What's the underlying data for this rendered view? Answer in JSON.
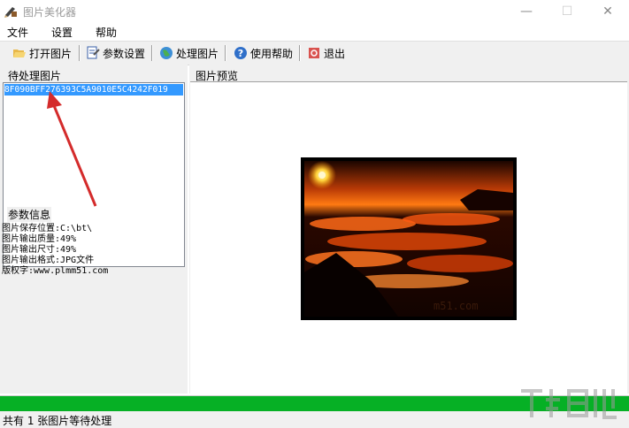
{
  "window": {
    "title": "图片美化器",
    "minimize": "—",
    "maximize": "☐",
    "close": "✕"
  },
  "menu": [
    "文件",
    "设置",
    "帮助"
  ],
  "toolbar": {
    "open": "打开图片",
    "params": "参数设置",
    "process": "处理图片",
    "help": "使用帮助",
    "exit": "退出"
  },
  "pending": {
    "label": "待处理图片",
    "items": [
      "8F090BFF276393C5A9010E5C4242F019"
    ]
  },
  "params": {
    "label": "参数信息",
    "lines": [
      "图片保存位置:C:\\bt\\",
      "图片输出质量:49%",
      "图片输出尺寸:49%",
      "图片输出格式:JPG文件",
      "版权字:www.plmm51.com"
    ]
  },
  "preview": {
    "label": "图片预览",
    "image_text": "m51.com"
  },
  "progress": {
    "fraction": 1.0,
    "color": "#06b025"
  },
  "status": {
    "text": "共有 1 张图片等待处理"
  },
  "colors": {
    "selection": "#3399ff",
    "arrow": "#d42b2b"
  },
  "icons": {
    "app": "pencil-image-icon",
    "open": "folder-open-icon",
    "params": "settings-doc-icon",
    "process": "globe-icon",
    "help": "help-icon",
    "exit": "exit-icon"
  }
}
